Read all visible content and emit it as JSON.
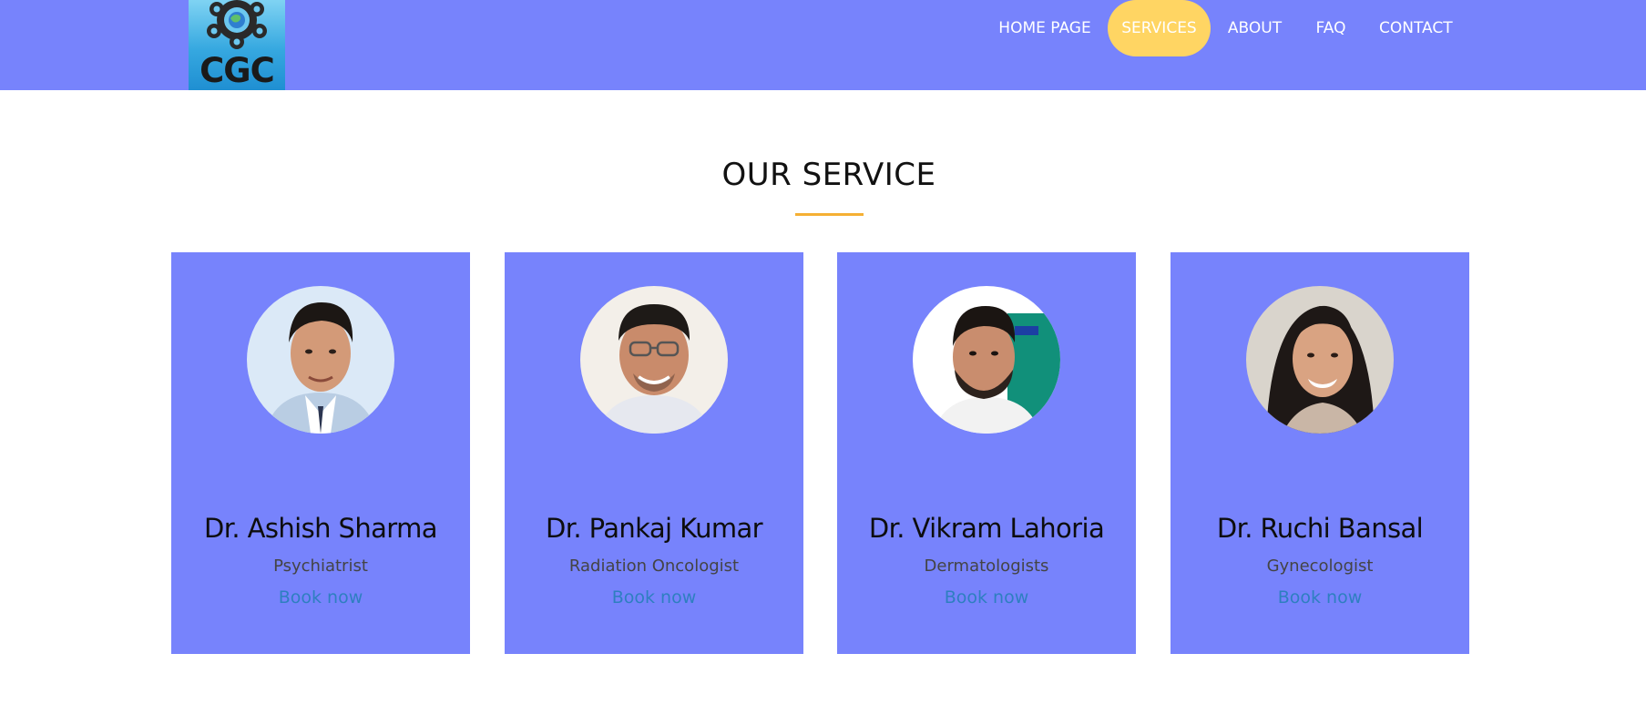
{
  "logo": {
    "text": "CGC",
    "icon": "gear-cluster-globe-icon"
  },
  "nav": {
    "items": [
      {
        "label": "HOME PAGE",
        "active": false
      },
      {
        "label": "SERVICES",
        "active": true
      },
      {
        "label": "ABOUT",
        "active": false
      },
      {
        "label": "FAQ",
        "active": false
      },
      {
        "label": "CONTACT",
        "active": false
      }
    ]
  },
  "section": {
    "title": "OUR SERVICE"
  },
  "doctors": [
    {
      "name": "Dr. Ashish Sharma",
      "role": "Psychiatrist",
      "cta": "Book now"
    },
    {
      "name": "Dr. Pankaj Kumar",
      "role": "Radiation Oncologist",
      "cta": "Book now"
    },
    {
      "name": "Dr. Vikram Lahoria",
      "role": "Dermatologists",
      "cta": "Book now"
    },
    {
      "name": "Dr. Ruchi Bansal",
      "role": "Gynecologist",
      "cta": "Book now"
    }
  ],
  "colors": {
    "header_bg": "#7783fc",
    "card_bg": "#7783fc",
    "active_nav": "#ffd563",
    "accent_underline": "#f5b034",
    "link": "#2e7fc0"
  }
}
